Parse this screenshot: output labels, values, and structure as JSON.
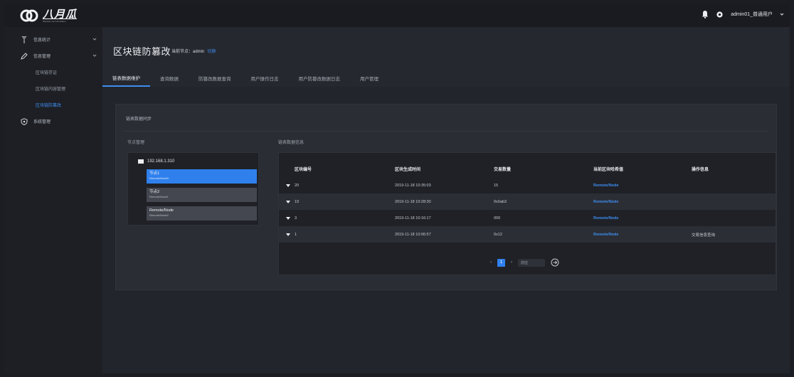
{
  "header": {
    "logo_text": "八月瓜",
    "logo_subtext": "Wireless communication",
    "user": "admin01_普通用户"
  },
  "sidebar": {
    "items": [
      {
        "label": "信息统计",
        "icon": "antenna-icon",
        "has_caret": true
      },
      {
        "label": "信息管理",
        "icon": "pen-icon",
        "has_caret": true
      }
    ],
    "sub_items": [
      {
        "label": "区块链存证"
      },
      {
        "label": "区块链内容管理"
      },
      {
        "label": "区块链防篡改",
        "active": true
      }
    ],
    "bottom_item": {
      "label": "系统管理",
      "icon": "shield-icon"
    }
  },
  "page": {
    "title": "区块链防篡改",
    "meta": "当前节点：admin",
    "meta_link": "切换"
  },
  "tabs": [
    "链表数据维护",
    "查询数据",
    "防篡改数据查询",
    "用户操作日志",
    "用户防篡改数据日志",
    "用户管理"
  ],
  "card": {
    "title": "链表数据同步",
    "left_label": "节点管理",
    "right_label": "链表数据信息"
  },
  "tree": {
    "root": "192.168.1.310",
    "nodes": [
      {
        "name": "节点1",
        "sub": "Remote/Node0"
      },
      {
        "name": "节点2",
        "sub": "Remote/Node1"
      },
      {
        "name": "Remote/Node",
        "sub": "Remote/Node2"
      }
    ]
  },
  "table": {
    "columns": [
      "区块编号",
      "区块生成时间",
      "交易数量",
      "当前区块哈希值",
      "操作信息"
    ],
    "rows": [
      {
        "id": "20",
        "time": "2019-11-18 10:35:03",
        "count": "15",
        "hash": "Remote/Node",
        "op": ""
      },
      {
        "id": "19",
        "time": "2019-11-18 10:28:30",
        "count": "0x0ab3",
        "hash": "Remote/Node",
        "op": ""
      },
      {
        "id": "3",
        "time": "2019-11-18 10:16:17",
        "count": "000",
        "hash": "Remote/Node",
        "op": ""
      },
      {
        "id": "1",
        "time": "2019-11-18 10:06:57",
        "count": "0x12",
        "hash": "Remote/Node",
        "op": "交易信息查询"
      }
    ]
  },
  "pager": {
    "prev": "‹",
    "page": "1",
    "next": "›",
    "jump_placeholder": "前往",
    "go_icon": "arrow-right-circle-icon"
  }
}
